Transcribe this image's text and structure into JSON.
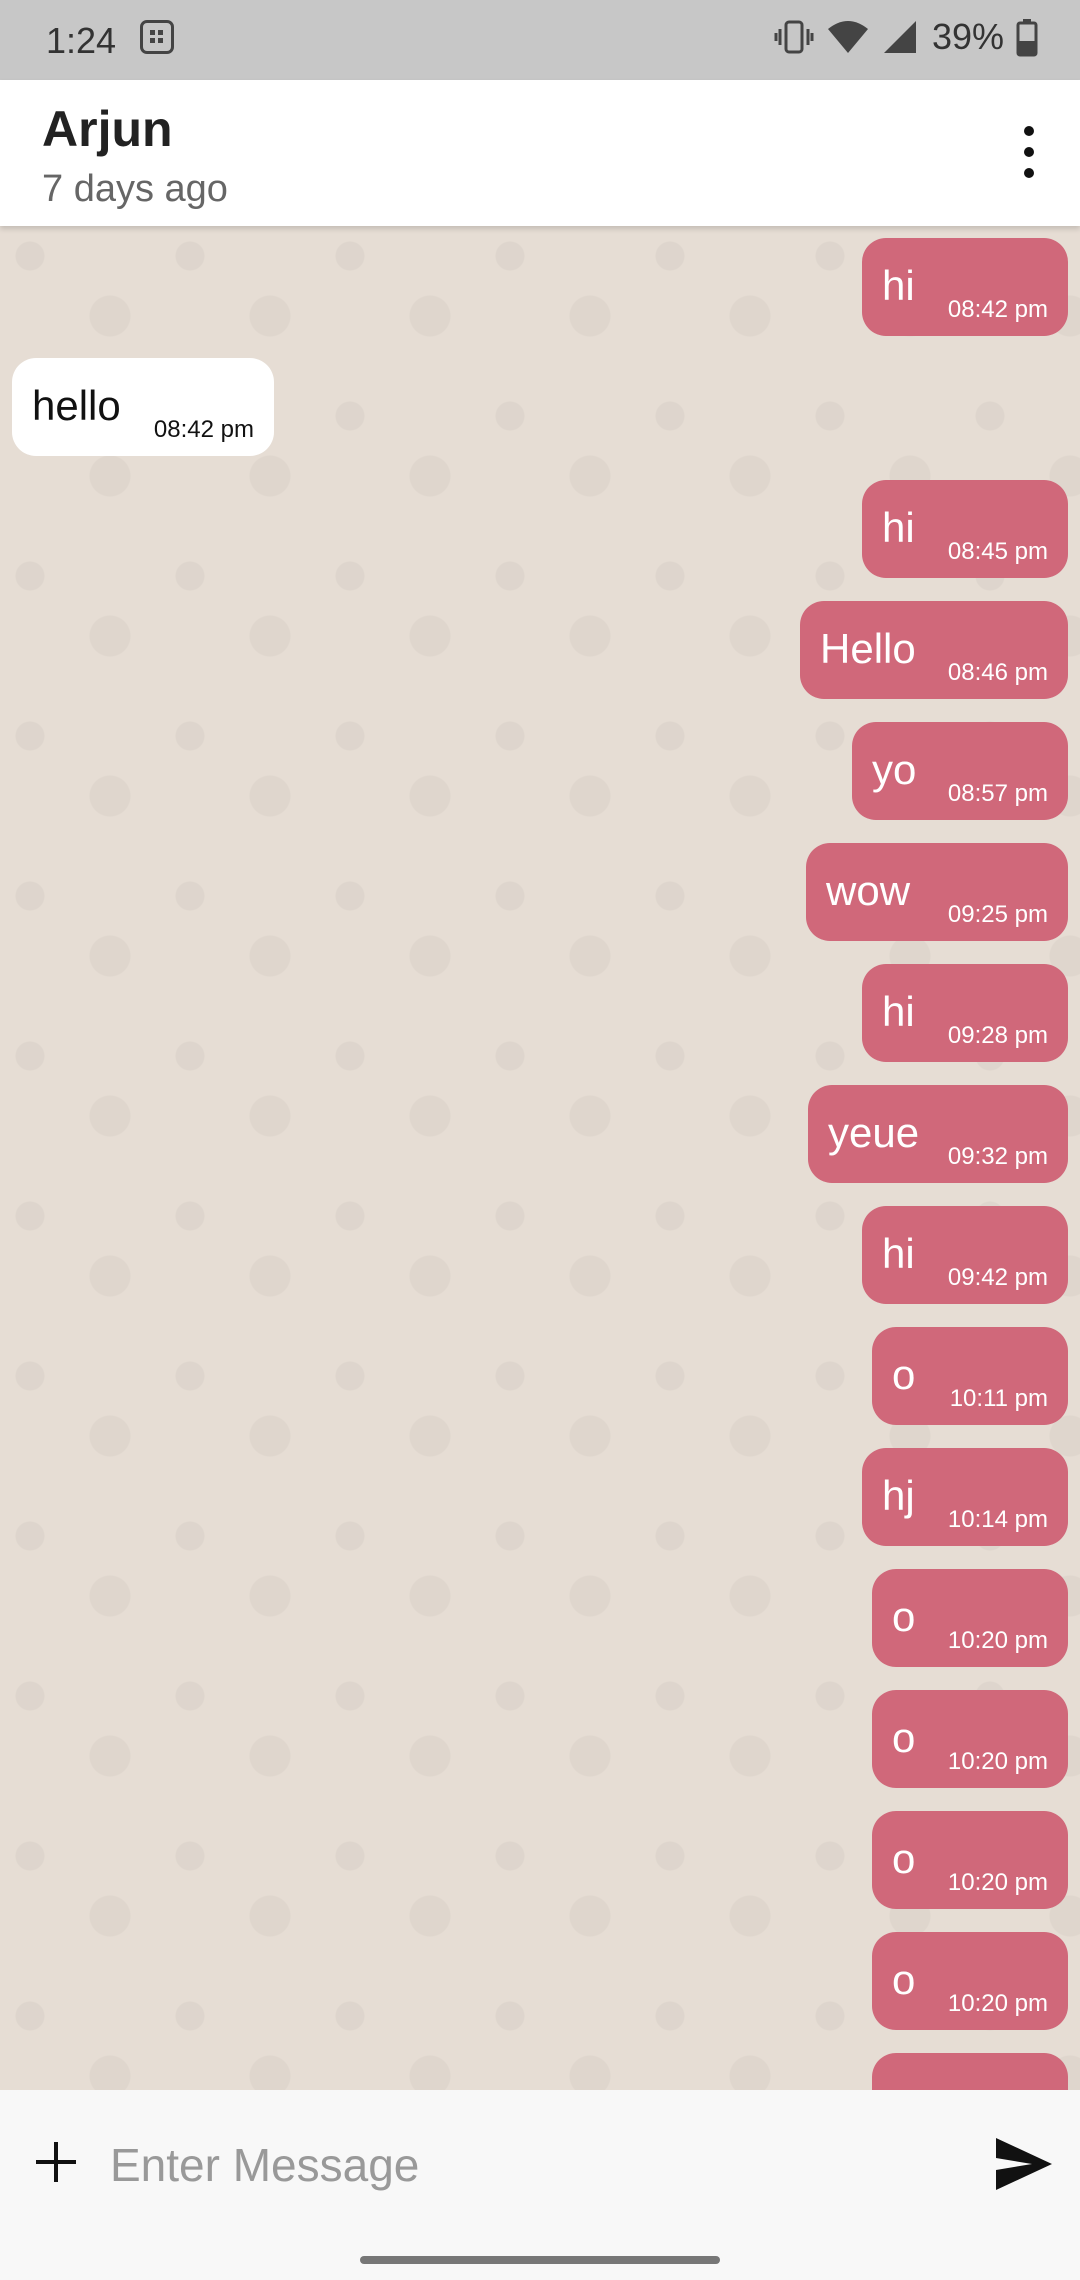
{
  "status_bar": {
    "time": "1:24",
    "battery": "39%"
  },
  "header": {
    "name": "Arjun",
    "last_seen": "7 days ago"
  },
  "messages": [
    {
      "dir": "out",
      "text": "hi",
      "time": "08:42 pm"
    },
    {
      "dir": "in",
      "text": "hello",
      "time": "08:42 pm"
    },
    {
      "dir": "out",
      "text": "hi",
      "time": "08:45 pm"
    },
    {
      "dir": "out",
      "text": "Hello",
      "time": "08:46 pm"
    },
    {
      "dir": "out",
      "text": "yo",
      "time": "08:57 pm"
    },
    {
      "dir": "out",
      "text": "wow",
      "time": "09:25 pm"
    },
    {
      "dir": "out",
      "text": "hi",
      "time": "09:28 pm"
    },
    {
      "dir": "out",
      "text": "yeue",
      "time": "09:32 pm"
    },
    {
      "dir": "out",
      "text": "hi",
      "time": "09:42 pm"
    },
    {
      "dir": "out",
      "text": "o",
      "time": "10:11 pm"
    },
    {
      "dir": "out",
      "text": "hj",
      "time": "10:14 pm"
    },
    {
      "dir": "out",
      "text": "o",
      "time": "10:20 pm"
    },
    {
      "dir": "out",
      "text": "o",
      "time": "10:20 pm"
    },
    {
      "dir": "out",
      "text": "o",
      "time": "10:20 pm"
    },
    {
      "dir": "out",
      "text": "o",
      "time": "10:20 pm"
    },
    {
      "dir": "out",
      "text": "",
      "time": ""
    }
  ],
  "input": {
    "placeholder": "Enter Message"
  },
  "colors": {
    "outgoing_bubble": "#d0687a",
    "incoming_bubble": "#ffffff",
    "chat_background": "#e6ddd4"
  }
}
